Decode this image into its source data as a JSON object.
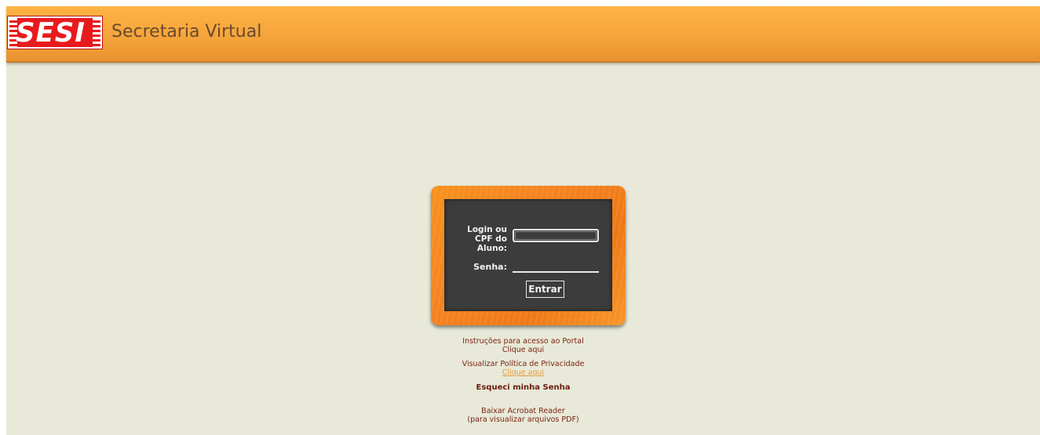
{
  "header": {
    "logo_text": "SESI",
    "app_title": "Secretaria Virtual"
  },
  "login_form": {
    "login_label_line1": "Login ou",
    "login_label_line2": "CPF do Aluno:",
    "login_value": "",
    "password_label": "Senha:",
    "password_value": "",
    "submit_label": "Entrar"
  },
  "links": {
    "instructions_text": "Instruções para acesso ao Portal",
    "instructions_link": "Clique aqui",
    "privacy_text": "Visualizar Política de Privacidade",
    "privacy_link": "Clique aqui",
    "forgot_password": "Esqueci minha Senha",
    "acrobat_text": "Baixar Acrobat Reader",
    "acrobat_sub": "(para visualizar arquivos PDF)"
  },
  "colors": {
    "header_orange": "#f4a33a",
    "background": "#e8e9d8",
    "board_orange": "#f58220",
    "slate": "#3c3c3c",
    "link_text": "#7a1f14",
    "link_highlight": "#e89a3a"
  }
}
